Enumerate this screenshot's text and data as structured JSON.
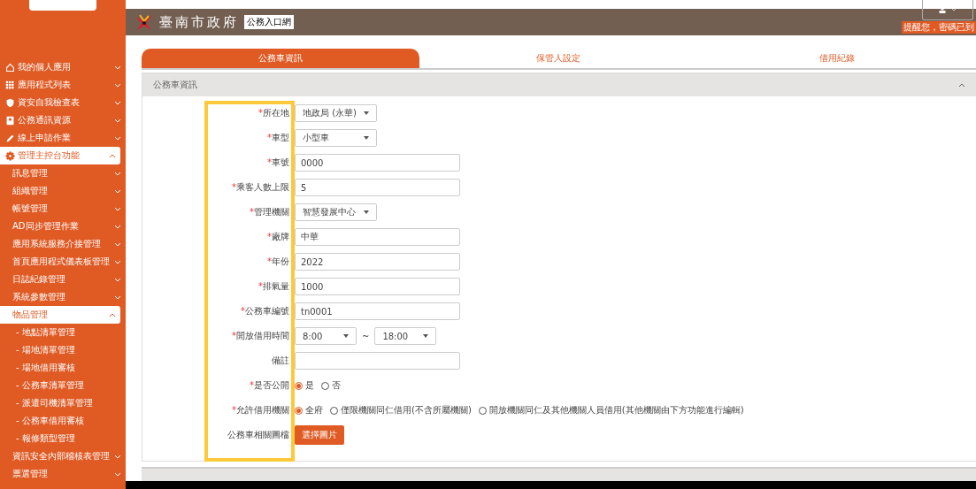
{
  "header": {
    "logo_text": "臺南市政府",
    "portal_label": "公務入口網",
    "notice": "提醒您，密碼已到"
  },
  "sidebar": {
    "items": [
      {
        "label": "我的個人應用",
        "kind": "group",
        "expanded": false
      },
      {
        "label": "應用程式列表",
        "kind": "group",
        "expanded": false
      },
      {
        "label": "資安自我檢查表",
        "kind": "group",
        "expanded": false
      },
      {
        "label": "公務通訊資源",
        "kind": "group",
        "expanded": false
      },
      {
        "label": "線上申請作業",
        "kind": "group",
        "expanded": false
      },
      {
        "label": "管理主控台功能",
        "kind": "group",
        "expanded": true,
        "children": [
          {
            "label": "訊息管理",
            "kind": "group",
            "expanded": false
          },
          {
            "label": "組織管理",
            "kind": "group",
            "expanded": false
          },
          {
            "label": "帳號管理",
            "kind": "group",
            "expanded": false
          },
          {
            "label": "AD同步管理作業",
            "kind": "group",
            "expanded": false
          },
          {
            "label": "應用系統服務介接管理",
            "kind": "group",
            "expanded": false
          },
          {
            "label": "首頁應用程式儀表板管理",
            "kind": "group",
            "expanded": false
          },
          {
            "label": "日誌紀錄管理",
            "kind": "group",
            "expanded": false
          },
          {
            "label": "系統參數管理",
            "kind": "group",
            "expanded": false
          },
          {
            "label": "物品管理",
            "kind": "group",
            "expanded": true,
            "children": [
              {
                "label": "- 地點清單管理",
                "kind": "link"
              },
              {
                "label": "- 場地清單管理",
                "kind": "link"
              },
              {
                "label": "- 場地借用審核",
                "kind": "link"
              },
              {
                "label": "- 公務車清單管理",
                "kind": "link"
              },
              {
                "label": "- 派遣司機清單管理",
                "kind": "link"
              },
              {
                "label": "- 公務車借用審核",
                "kind": "link"
              },
              {
                "label": "- 報修類型管理",
                "kind": "link"
              }
            ]
          },
          {
            "label": "資訊安全內部稽核表管理",
            "kind": "group",
            "expanded": false
          },
          {
            "label": "票選管理",
            "kind": "group",
            "expanded": false
          }
        ]
      }
    ]
  },
  "tabs": [
    {
      "label": "公務車資訊",
      "selected": true
    },
    {
      "label": "保管人設定",
      "selected": false
    },
    {
      "label": "借用紀錄",
      "selected": false
    }
  ],
  "panel": {
    "title": "公務車資訊",
    "expanded": true
  },
  "fields": [
    {
      "kind": "select",
      "mark": "*",
      "label": "所在地",
      "value": "地政局 (永華)"
    },
    {
      "kind": "select",
      "mark": "*",
      "label": "車型",
      "value": "小型車"
    },
    {
      "kind": "text",
      "mark": "*",
      "label": "車號",
      "value": "0000"
    },
    {
      "kind": "text",
      "mark": "*",
      "label": "乘客人數上限",
      "value": "5"
    },
    {
      "kind": "select",
      "mark": "*",
      "label": "管理機關",
      "value": "智慧發展中心"
    },
    {
      "kind": "text",
      "mark": "*",
      "label": "廠牌",
      "value": "中華"
    },
    {
      "kind": "text",
      "mark": "*",
      "label": "年份",
      "value": "2022"
    },
    {
      "kind": "text",
      "mark": "*",
      "label": "排氣量",
      "value": "1000"
    },
    {
      "kind": "text",
      "mark": "*",
      "label": "公務車編號",
      "value": "tn0001"
    },
    {
      "kind": "timerange",
      "mark": "*",
      "label": "開放借用時間",
      "from": "8:00",
      "separator": "~",
      "to": "18:00"
    },
    {
      "kind": "text",
      "label": "備註"
    },
    {
      "kind": "radio",
      "mark": "*",
      "label": "是否公開",
      "options": [
        {
          "label": "是",
          "selected": true
        },
        {
          "label": "否",
          "selected": false
        }
      ]
    },
    {
      "kind": "radio",
      "mark": "*",
      "label": "允許借用機關",
      "options": [
        {
          "label": "全府",
          "selected": true
        },
        {
          "label": "僅限機關同仁借用(不含所屬機關)",
          "selected": false
        },
        {
          "label": "開放機關同仁及其他機關人員借用(其他機關由下方功能進行編輯)",
          "selected": false
        }
      ]
    },
    {
      "kind": "file",
      "label": "公務車相關圖檔",
      "button": "選擇圖片"
    }
  ]
}
